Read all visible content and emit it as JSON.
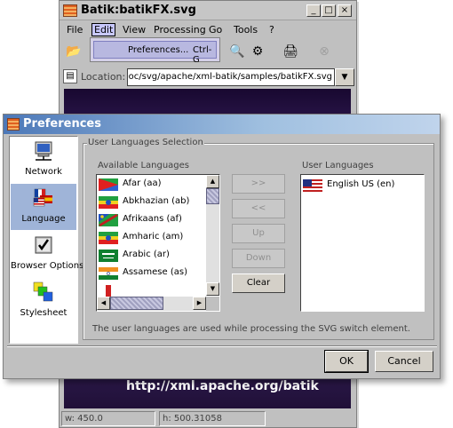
{
  "batik": {
    "title": "Batik:batikFX.svg",
    "menu": {
      "file": "File",
      "edit": "Edit",
      "view": "View",
      "processing": "Processing",
      "go": "Go",
      "tools": "Tools",
      "help": "?"
    },
    "edit_menu": {
      "preferences": "Preferences...",
      "preferences_shortcut": "Ctrl-G"
    },
    "location": {
      "label": "Location:",
      "value": "rk/Doc/svg/apache/xml-batik/samples/batikFX.svg"
    },
    "canvas_banner": "http://xml.apache.org/batik",
    "status": {
      "width": "w: 450.0",
      "height": "h: 500.31058"
    }
  },
  "prefs": {
    "title": "Preferences",
    "sidebar": [
      {
        "label": "Network",
        "icon": "network-computer-icon"
      },
      {
        "label": "Language",
        "icon": "language-flags-icon"
      },
      {
        "label": "Browser Options",
        "icon": "checkbox-icon"
      },
      {
        "label": "Stylesheet",
        "icon": "stylesheet-squares-icon"
      }
    ],
    "group_title": "User Languages Selection",
    "available_label": "Available Languages",
    "user_label": "User Languages",
    "available": [
      {
        "name": "Afar (aa)",
        "flag": "eritrea-flag-icon"
      },
      {
        "name": "Abkhazian (ab)",
        "flag": "ethiopia-flag-icon"
      },
      {
        "name": "Afrikaans (af)",
        "flag": "namibia-flag-icon"
      },
      {
        "name": "Amharic (am)",
        "flag": "ethiopia-flag-icon"
      },
      {
        "name": "Arabic (ar)",
        "flag": "saudi-flag-icon"
      },
      {
        "name": "Assamese (as)",
        "flag": "india-flag-icon"
      }
    ],
    "user_languages": [
      {
        "name": "English US (en)",
        "flag": "us-flag-icon"
      }
    ],
    "buttons": {
      "add": ">>",
      "remove": "<<",
      "up": "Up",
      "down": "Down",
      "clear": "Clear"
    },
    "note": "The user languages are used while processing the SVG switch element.",
    "ok": "OK",
    "cancel": "Cancel"
  }
}
